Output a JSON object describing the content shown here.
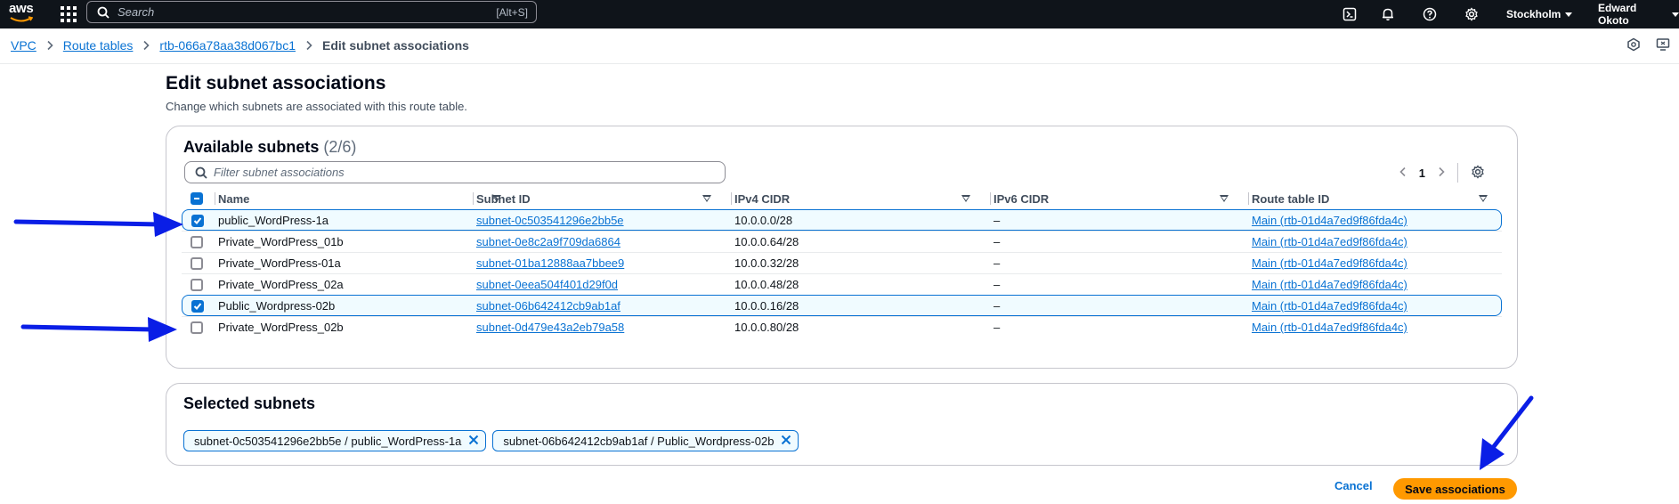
{
  "topbar": {
    "logo_text": "aws",
    "search_placeholder": "Search",
    "search_shortcut": "[Alt+S]",
    "region": "Stockholm",
    "user": "Edward Okoto"
  },
  "breadcrumbs": [
    {
      "label": "VPC"
    },
    {
      "label": "Route tables"
    },
    {
      "label": "rtb-066a78aa38d067bc1"
    },
    {
      "label": "Edit subnet associations"
    }
  ],
  "page": {
    "title": "Edit subnet associations",
    "description": "Change which subnets are associated with this route table."
  },
  "available": {
    "title": "Available subnets",
    "count": "(2/6)",
    "filter_placeholder": "Filter subnet associations",
    "page_number": "1",
    "columns": [
      "Name",
      "Subnet ID",
      "IPv4 CIDR",
      "IPv6 CIDR",
      "Route table ID"
    ],
    "rows": [
      {
        "name": "public_WordPress-1a",
        "subnet_id": "subnet-0c503541296e2bb5e",
        "ipv4": "10.0.0.0/28",
        "ipv6": "–",
        "route_table": "Main (rtb-01d4a7ed9f86fda4c)",
        "selected": true
      },
      {
        "name": "Private_WordPress_01b",
        "subnet_id": "subnet-0e8c2a9f709da6864",
        "ipv4": "10.0.0.64/28",
        "ipv6": "–",
        "route_table": "Main (rtb-01d4a7ed9f86fda4c)",
        "selected": false
      },
      {
        "name": "Private_WordPress-01a",
        "subnet_id": "subnet-01ba12888aa7bbee9",
        "ipv4": "10.0.0.32/28",
        "ipv6": "–",
        "route_table": "Main (rtb-01d4a7ed9f86fda4c)",
        "selected": false
      },
      {
        "name": "Private_WordPress_02a",
        "subnet_id": "subnet-0eea504f401d29f0d",
        "ipv4": "10.0.0.48/28",
        "ipv6": "–",
        "route_table": "Main (rtb-01d4a7ed9f86fda4c)",
        "selected": false
      },
      {
        "name": "Public_Wordpress-02b",
        "subnet_id": "subnet-06b642412cb9ab1af",
        "ipv4": "10.0.0.16/28",
        "ipv6": "–",
        "route_table": "Main (rtb-01d4a7ed9f86fda4c)",
        "selected": true
      },
      {
        "name": "Private_WordPress_02b",
        "subnet_id": "subnet-0d479e43a2eb79a58",
        "ipv4": "10.0.0.80/28",
        "ipv6": "–",
        "route_table": "Main (rtb-01d4a7ed9f86fda4c)",
        "selected": false
      }
    ]
  },
  "selected": {
    "title": "Selected subnets",
    "tokens": [
      {
        "label": "subnet-0c503541296e2bb5e / public_WordPress-1a"
      },
      {
        "label": "subnet-06b642412cb9ab1af / Public_Wordpress-02b"
      }
    ]
  },
  "actions": {
    "cancel": "Cancel",
    "save": "Save associations"
  },
  "colors": {
    "link": "#0972d3",
    "primary_button": "#ff9900",
    "annotation_arrow": "#0a1ee6",
    "topbar": "#0f141a"
  }
}
